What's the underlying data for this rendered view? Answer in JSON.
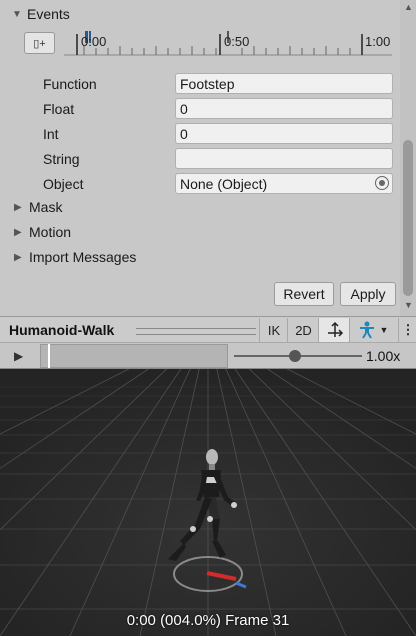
{
  "events": {
    "title": "Events",
    "add_icon": "add-event-icon",
    "timeline_ticks": [
      "0:00",
      "0:50",
      "1:00"
    ]
  },
  "fields": {
    "function_label": "Function",
    "function_value": "Footstep",
    "float_label": "Float",
    "float_value": "0",
    "int_label": "Int",
    "int_value": "0",
    "string_label": "String",
    "string_value": "",
    "object_label": "Object",
    "object_value": "None (Object)"
  },
  "sections": {
    "mask": "Mask",
    "motion": "Motion",
    "import_messages": "Import Messages"
  },
  "buttons": {
    "revert": "Revert",
    "apply": "Apply"
  },
  "preview": {
    "title": "Humanoid-Walk",
    "ik": "IK",
    "two_d": "2D",
    "speed": "1.00x",
    "status": "0:00 (004.0%) Frame 31",
    "icons": [
      "pivot-icon",
      "avatar-icon",
      "dropdown-icon",
      "more-icon",
      "play-icon"
    ]
  },
  "colors": {
    "viewport_bg": "#2b2b2b",
    "grid": "#5a5a5a",
    "x_axis": "#d22b2b",
    "z_axis": "#3a7bd5"
  }
}
